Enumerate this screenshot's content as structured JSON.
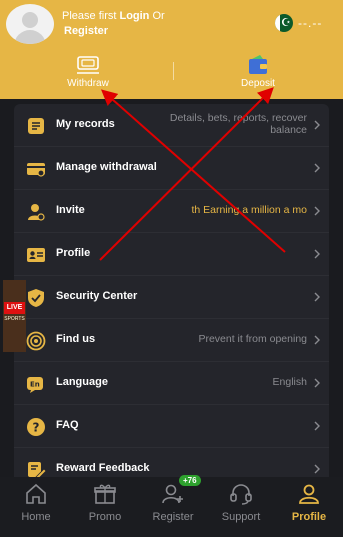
{
  "header": {
    "login_prefix": "Please first ",
    "login_link": "Login",
    "login_or": " Or",
    "register": "Register",
    "balance": "--.--",
    "flag_icon": "pakistan-flag-icon"
  },
  "actions": {
    "withdraw": "Withdraw",
    "deposit": "Deposit"
  },
  "menu": {
    "items": [
      {
        "label": "My records",
        "value_line1": "Details, bets, reports, recover",
        "value_line2": "balance",
        "icon": "records-icon"
      },
      {
        "label": "Manage withdrawal",
        "value": "",
        "icon": "card-icon"
      },
      {
        "label": "Invite",
        "value": "th  Earning a million a mo",
        "icon": "invite-icon"
      },
      {
        "label": "Profile",
        "value": "",
        "icon": "id-card-icon"
      },
      {
        "label": "Security Center",
        "value": "",
        "icon": "shield-icon"
      },
      {
        "label": "Find us",
        "value": "Prevent it from opening",
        "icon": "target-icon"
      },
      {
        "label": "Language",
        "value": "English",
        "icon": "language-icon"
      },
      {
        "label": "FAQ",
        "value": "",
        "icon": "question-icon"
      },
      {
        "label": "Reward Feedback",
        "value": "",
        "icon": "feedback-icon"
      }
    ]
  },
  "live_banner": {
    "badge": "LIVE",
    "sub": "SPORTS"
  },
  "tabs": [
    {
      "label": "Home",
      "icon": "home-icon"
    },
    {
      "label": "Promo",
      "icon": "gift-icon"
    },
    {
      "label": "Register",
      "icon": "add-user-icon",
      "badge": "+76"
    },
    {
      "label": "Support",
      "icon": "headset-icon"
    },
    {
      "label": "Profile",
      "icon": "person-icon",
      "active": true
    }
  ],
  "colors": {
    "accent": "#e6b645",
    "background": "#1a1b1f",
    "card": "#24252b",
    "muted": "#8a8b90",
    "annotation": "#e00000"
  }
}
